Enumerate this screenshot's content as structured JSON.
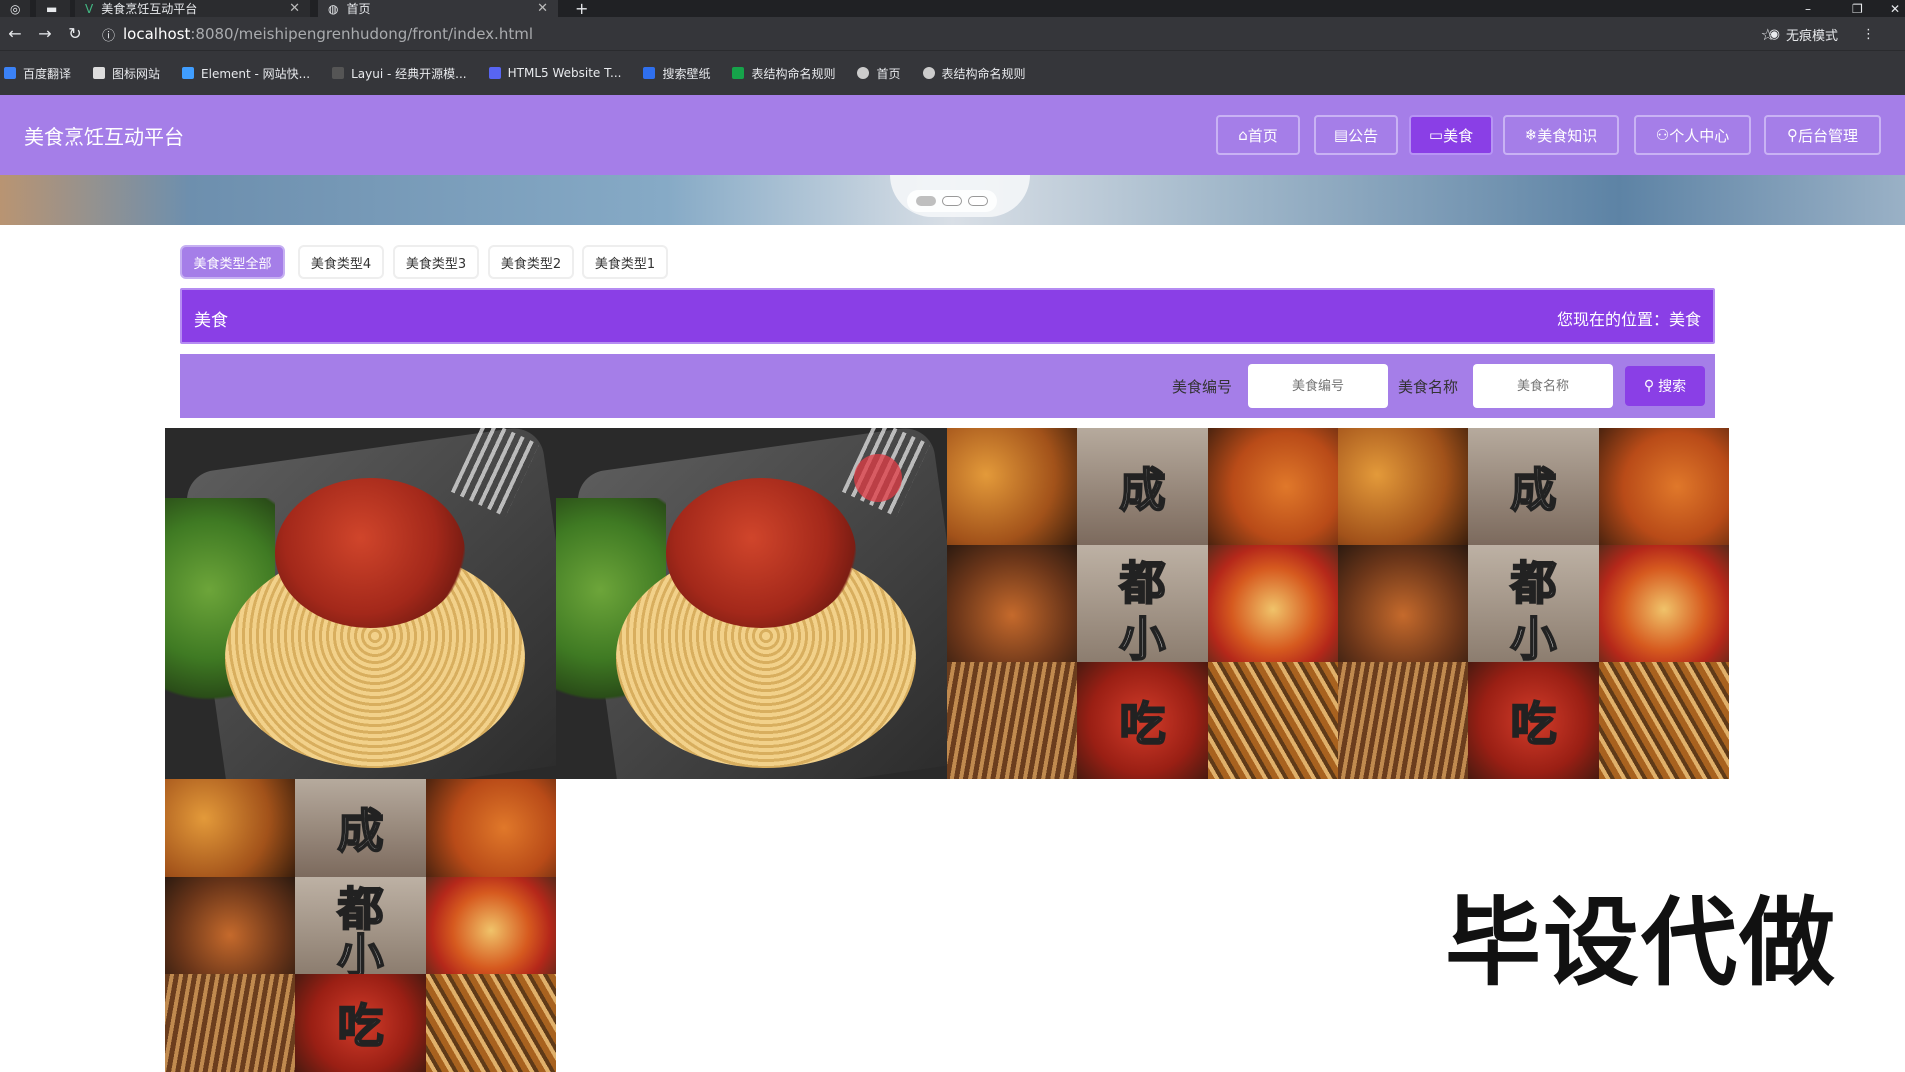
{
  "browser": {
    "tabs": [
      {
        "title": "美食烹饪互动平台",
        "active": false
      },
      {
        "title": "首页",
        "active": true
      }
    ],
    "url_host": "localhost",
    "url_path": ":8080/meishipengrenhudong/front/index.html",
    "profile_label": "无痕模式",
    "bookmarks": [
      "百度翻译",
      "图标网站",
      "Element - 网站快...",
      "Layui - 经典开源模...",
      "HTML5 Website T...",
      "搜索壁纸",
      "表结构命名规则",
      "首页",
      "表结构命名规则"
    ]
  },
  "header": {
    "site_title": "美食烹饪互动平台",
    "nav": [
      {
        "label": "首页",
        "icon": "home-icon",
        "glyph": "⌂",
        "active": false
      },
      {
        "label": "公告",
        "icon": "notice-icon",
        "glyph": "▤",
        "active": false
      },
      {
        "label": "美食",
        "icon": "food-icon",
        "glyph": "▭",
        "active": true
      },
      {
        "label": "美食知识",
        "icon": "knowledge-icon",
        "glyph": "❄",
        "active": false
      },
      {
        "label": "个人中心",
        "icon": "user-icon",
        "glyph": "⚇",
        "active": false
      },
      {
        "label": "后台管理",
        "icon": "link-icon",
        "glyph": "⚲",
        "active": false
      }
    ]
  },
  "categories": [
    "美食类型全部",
    "美食类型4",
    "美食类型3",
    "美食类型2",
    "美食类型1"
  ],
  "title_bar": {
    "left": "美食",
    "right": "您现在的位置：美食"
  },
  "search": {
    "field1_label": "美食编号",
    "field1_placeholder": "美食编号",
    "field2_label": "美食名称",
    "field2_placeholder": "美食名称",
    "button_label": "搜索"
  },
  "food_cards": [
    {
      "type": "spaghetti"
    },
    {
      "type": "spaghetti"
    },
    {
      "type": "collage",
      "characters": [
        "成",
        "都",
        "小",
        "吃"
      ]
    },
    {
      "type": "collage",
      "characters": [
        "成",
        "都",
        "小",
        "吃"
      ]
    },
    {
      "type": "collage",
      "characters": [
        "成",
        "都",
        "小",
        "吃"
      ]
    }
  ],
  "overlay_text": "毕设代做",
  "colors": {
    "header": "#a57ee8",
    "accent": "#8a3fe6"
  }
}
